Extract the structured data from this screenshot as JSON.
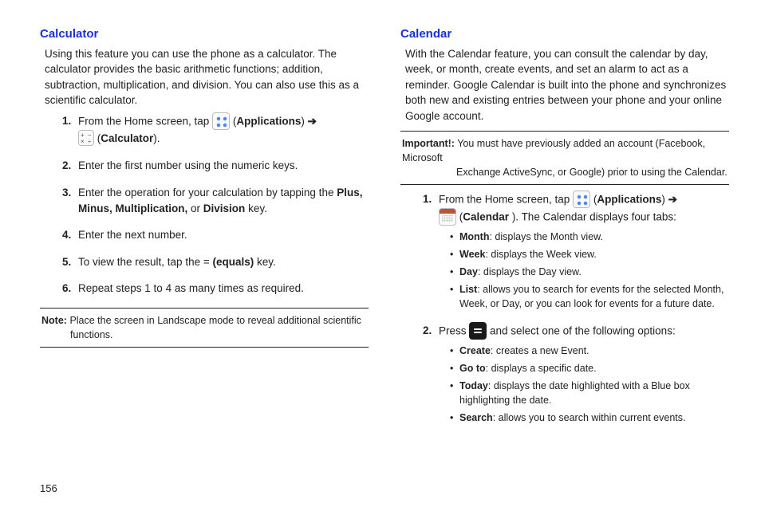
{
  "page_number": "156",
  "left": {
    "heading": "Calculator",
    "intro": "Using this feature you can use the phone as a calculator. The calculator provides the basic arithmetic functions; addition, subtraction, multiplication, and division. You can also use this as a scientific calculator.",
    "s1a": "From the Home screen, tap ",
    "s1_apps": "Applications",
    "s1_arrow": " ➔ ",
    "s1_calc": "Calculator",
    "s2": "Enter the first number using the numeric keys.",
    "s3a": "Enter the operation for your calculation by tapping the ",
    "s3b": "Plus, Minus, Multiplication,",
    "s3c": " or ",
    "s3d": "Division",
    "s3e": " key.",
    "s4": "Enter the next number.",
    "s5a": "To view the result, tap the = ",
    "s5b": "(equals)",
    "s5c": " key.",
    "s6": "Repeat steps 1 to 4 as many times as required.",
    "note_lbl": "Note:",
    "note_body": "Place the screen in Landscape mode to reveal additional scientific functions."
  },
  "right": {
    "heading": "Calendar",
    "intro": "With the Calendar feature, you can consult the calendar by day, week, or month, create events, and set an alarm to act as a reminder. Google Calendar is built into the phone and synchronizes both new and existing entries between your phone and your online Google account.",
    "imp_lbl": "Important!:",
    "imp_body": "You must have previously added an account (Facebook, Microsoft Exchange ActiveSync, or Google) prior to using the Calendar.",
    "s1a": "From the Home screen, tap ",
    "s1_apps": "Applications",
    "s1_arrow": " ➔ ",
    "s1_cal": "Calendar",
    "s1_tail": "). The Calendar displays four tabs:",
    "b_month_k": "Month",
    "b_month_v": ": displays the Month view.",
    "b_week_k": "Week",
    "b_week_v": ": displays the Week view.",
    "b_day_k": "Day",
    "b_day_v": ": displays the Day view.",
    "b_list_k": "List",
    "b_list_v": ": allows you to search for events for the selected Month, Week, or Day, or you can look for events for a future date.",
    "s2a": "Press ",
    "s2b": " and select one of the following options:",
    "c_create_k": "Create",
    "c_create_v": ": creates a new Event.",
    "c_goto_k": "Go to",
    "c_goto_v": ": displays a specific date.",
    "c_today_k": "Today",
    "c_today_v": ": displays the date highlighted with a Blue box highlighting the date.",
    "c_search_k": "Search",
    "c_search_v": ": allows you to search within current events."
  }
}
